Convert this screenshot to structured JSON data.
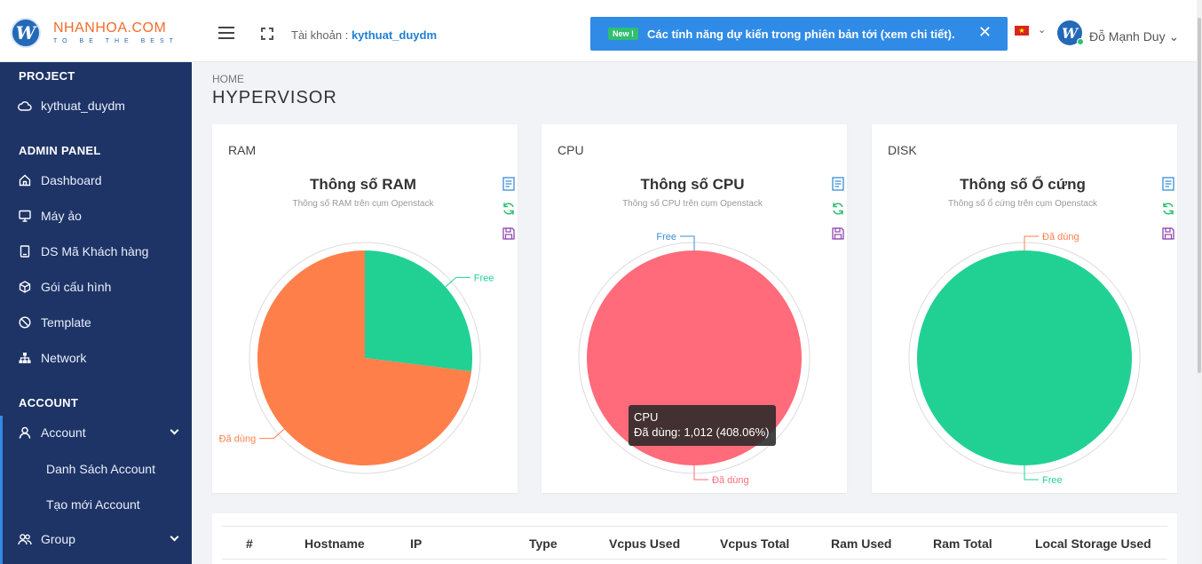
{
  "brand": {
    "logo_letter": "W",
    "name": "NHANHOA.COM",
    "slogan": "TO BE THE BEST"
  },
  "header": {
    "account_prefix": "Tài khoản :",
    "account_name": "kythuat_duydm",
    "notice_tag": "New !",
    "notice_text": "Các tính năng dự kiến trong phiên bản tới (xem chi tiết).",
    "notice_close": "✕",
    "flag_star": "★",
    "caret": "⌄",
    "avatar_letter": "W",
    "user_name": "Đỗ Mạnh Duy ⌄"
  },
  "sidebar": {
    "sections": {
      "project": "PROJECT",
      "admin": "ADMIN PANEL",
      "account": "ACCOUNT"
    },
    "project_item": {
      "label": "kythuat_duydm",
      "icon": "cloud-icon"
    },
    "admin_items": [
      {
        "label": "Dashboard",
        "icon": "home-icon"
      },
      {
        "label": "Máy ảo",
        "icon": "monitor-icon"
      },
      {
        "label": "DS Mã Khách hàng",
        "icon": "clipboard-icon"
      },
      {
        "label": "Gói cấu hình",
        "icon": "package-icon"
      },
      {
        "label": "Template",
        "icon": "template-icon"
      },
      {
        "label": "Network",
        "icon": "network-icon"
      }
    ],
    "account_items": [
      {
        "label": "Account",
        "icon": "user-icon"
      },
      {
        "label": "Group",
        "icon": "users-icon"
      }
    ],
    "account_sub": [
      "Danh Sách Account",
      "Tạo mới Account"
    ]
  },
  "main": {
    "breadcrumb": "HOME",
    "title": "HYPERVISOR",
    "cards": [
      {
        "label": "RAM",
        "title": "Thông số  RAM",
        "subtitle": "Thông số RAM trên cụm Openstack"
      },
      {
        "label": "CPU",
        "title": "Thông số  CPU",
        "subtitle": "Thông số CPU trên cụm Openstack"
      },
      {
        "label": "DISK",
        "title": "Thông số  Ổ cứng",
        "subtitle": "Thông số ổ cứng trên cụm Openstack"
      }
    ],
    "tooltip": {
      "title": "CPU",
      "text": "Đã dùng: 1,012 (408.06%)"
    },
    "table_headers": [
      "#",
      "Hostname",
      "IP",
      "Type",
      "Vcpus Used",
      "Vcpus Total",
      "Ram Used",
      "Ram Total",
      "Local Storage Used"
    ]
  },
  "chart_data": [
    {
      "type": "pie",
      "title": "Thông số  RAM",
      "subtitle": "Thông số RAM trên cụm Openstack",
      "labels": [
        "Free",
        "Đã dùng"
      ],
      "values": [
        27,
        73
      ],
      "colors": [
        "#21d193",
        "#ff7f4b"
      ]
    },
    {
      "type": "pie",
      "title": "Thông số  CPU",
      "subtitle": "Thông số CPU trên cụm Openstack",
      "labels": [
        "Đã dùng",
        "Free"
      ],
      "values": [
        1012,
        0
      ],
      "colors": [
        "#ff6b7a",
        "#3c8dd6"
      ]
    },
    {
      "type": "pie",
      "title": "Thông số  Ổ cứng",
      "subtitle": "Thông số ổ cứng trên cụm Openstack",
      "labels": [
        "Đã dùng",
        "Free"
      ],
      "values": [
        0,
        100
      ],
      "colors": [
        "#ff7f4b",
        "#21d193"
      ]
    }
  ]
}
